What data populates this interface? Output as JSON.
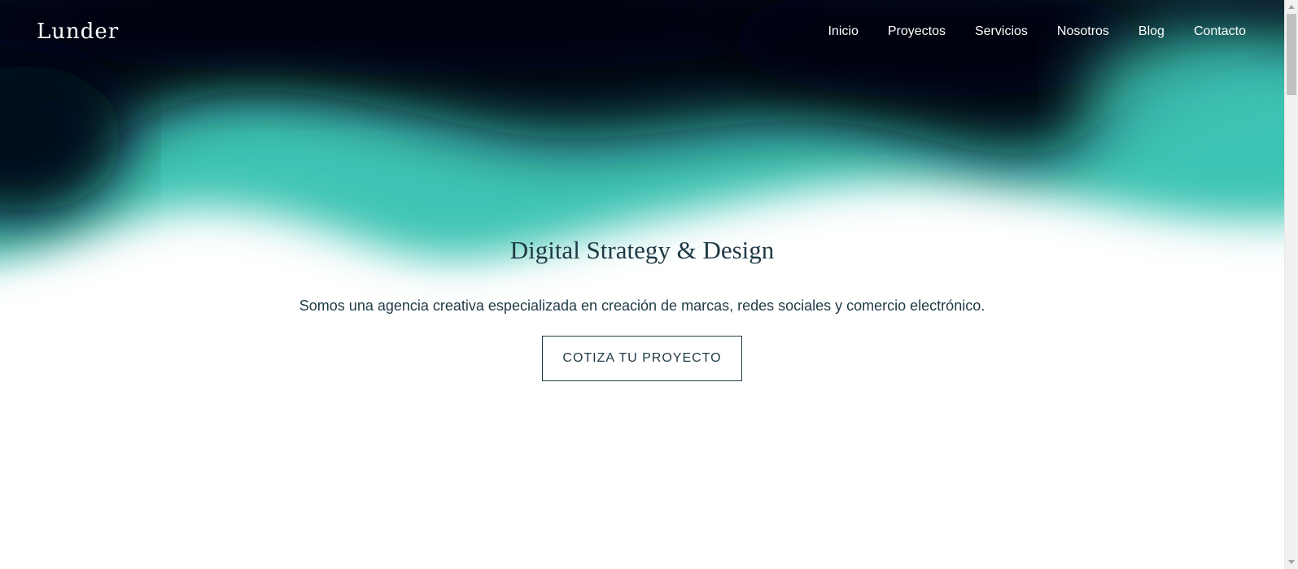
{
  "brand": {
    "name": "Lunder"
  },
  "nav": {
    "items": [
      {
        "label": "Inicio"
      },
      {
        "label": "Proyectos"
      },
      {
        "label": "Servicios"
      },
      {
        "label": "Nosotros"
      },
      {
        "label": "Blog"
      },
      {
        "label": "Contacto"
      }
    ]
  },
  "hero": {
    "title": "Digital Strategy & Design",
    "subtitle": "Somos una agencia creativa especializada en creación de marcas, redes sociales y comercio electrónico.",
    "cta_label": "COTIZA TU PROYECTO"
  },
  "colors": {
    "dark": "#05091a",
    "teal": "#3ec4b4",
    "text": "#1f3a45",
    "background": "#ffffff"
  }
}
